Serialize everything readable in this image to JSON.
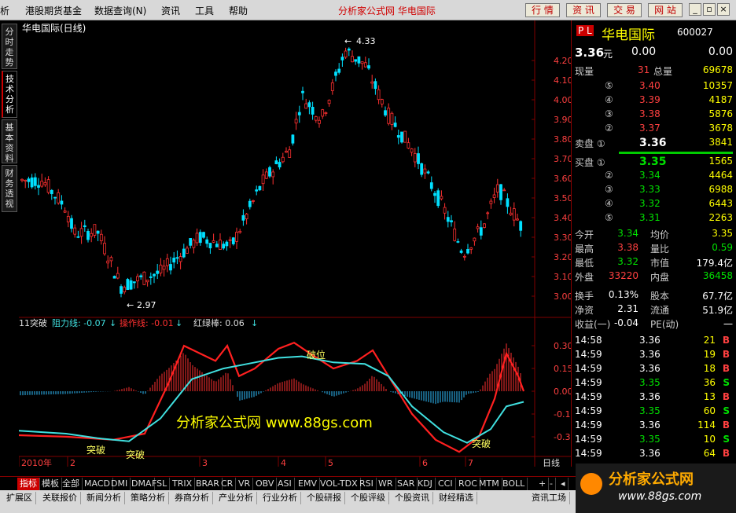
{
  "menu": {
    "items": [
      "析",
      "港股期货基金",
      "数据查询(N)",
      "资讯",
      "工具",
      "帮助"
    ],
    "center_title": "分析家公式网  华电国际",
    "right_buttons": [
      "行 情",
      "资 讯",
      "交 易",
      "网 站"
    ]
  },
  "left_tabs": [
    "分时走势",
    "技术分析",
    "基本资料",
    "财务透视"
  ],
  "chart": {
    "title": "华电国际(日线)",
    "high_label": "4.33",
    "low_label": "2.97",
    "price_ticks": [
      "4.20",
      "4.10",
      "4.00",
      "3.90",
      "3.80",
      "3.70",
      "3.60",
      "3.50",
      "3.40",
      "3.30",
      "3.20",
      "3.10",
      "3.00"
    ],
    "ind_header": {
      "name": "11突破",
      "s1": "阻力线: -0.07",
      "s2": "操作线: -0.01",
      "s3": "红绿棒: 0.06"
    },
    "ind_ticks": [
      "0.30",
      "0.15",
      "0.00",
      "-0.15",
      "-0.30"
    ],
    "annotations": [
      "突破",
      "突破",
      "破位",
      "突破"
    ],
    "xaxis": [
      "2010年",
      "2",
      "3",
      "4",
      "5",
      "6",
      "7"
    ],
    "period": "日线",
    "watermark": "分析家公式网  www.88gs.com"
  },
  "quote": {
    "pl": "P L",
    "name": "华电国际",
    "code": "600027",
    "price": "3.36",
    "unit": "元",
    "chg": "0.00",
    "pct": "0.00",
    "xianliang_label": "现量",
    "xianliang": "31",
    "zongliang_label": "总量",
    "zongliang": "69678",
    "asks": [
      {
        "n": "⑤",
        "p": "3.40",
        "v": "10357"
      },
      {
        "n": "④",
        "p": "3.39",
        "v": "4187"
      },
      {
        "n": "③",
        "p": "3.38",
        "v": "5876"
      },
      {
        "n": "②",
        "p": "3.37",
        "v": "3678"
      },
      {
        "n": "卖盘 ①",
        "p": "3.36",
        "v": "3841"
      }
    ],
    "bids": [
      {
        "n": "买盘 ①",
        "p": "3.35",
        "v": "1565"
      },
      {
        "n": "②",
        "p": "3.34",
        "v": "4464"
      },
      {
        "n": "③",
        "p": "3.33",
        "v": "6988"
      },
      {
        "n": "④",
        "p": "3.32",
        "v": "6443"
      },
      {
        "n": "⑤",
        "p": "3.31",
        "v": "2263"
      }
    ],
    "stats": [
      {
        "l1": "今开",
        "v1": "3.34",
        "l2": "均价",
        "v2": "3.35"
      },
      {
        "l1": "最高",
        "v1": "3.38",
        "l2": "量比",
        "v2": "0.59"
      },
      {
        "l1": "最低",
        "v1": "3.32",
        "l2": "市值",
        "v2": "179.4亿"
      },
      {
        "l1": "外盘",
        "v1": "33220",
        "l2": "内盘",
        "v2": "36458"
      }
    ],
    "stats2": [
      {
        "l1": "换手",
        "v1": "0.13%",
        "l2": "股本",
        "v2": "67.7亿"
      },
      {
        "l1": "净资",
        "v1": "2.31",
        "l2": "流通",
        "v2": "51.9亿"
      },
      {
        "l1": "收益(一)",
        "v1": "-0.04",
        "l2": "PE(动)",
        "v2": "一"
      }
    ],
    "ticks": [
      {
        "t": "14:58",
        "p": "3.36",
        "v": "21",
        "s": "B"
      },
      {
        "t": "14:59",
        "p": "3.36",
        "v": "19",
        "s": "B"
      },
      {
        "t": "14:59",
        "p": "3.36",
        "v": "18",
        "s": "B"
      },
      {
        "t": "14:59",
        "p": "3.35",
        "v": "36",
        "s": "S"
      },
      {
        "t": "14:59",
        "p": "3.36",
        "v": "13",
        "s": "B"
      },
      {
        "t": "14:59",
        "p": "3.35",
        "v": "60",
        "s": "S"
      },
      {
        "t": "14:59",
        "p": "3.36",
        "v": "114",
        "s": "B"
      },
      {
        "t": "14:59",
        "p": "3.35",
        "v": "10",
        "s": "S"
      },
      {
        "t": "14:59",
        "p": "3.36",
        "v": "64",
        "s": "B"
      }
    ]
  },
  "bottom_tabs1": [
    "指标",
    "模板",
    "全部",
    "MACD",
    "DMI",
    "DMA",
    "FSL",
    "TRIX",
    "BRAR",
    "CR",
    "VR",
    "OBV",
    "ASI",
    "EMV",
    "VOL-TDX",
    "RSI",
    "WR",
    "SAR",
    "KDJ",
    "CCI",
    "ROC",
    "MTM",
    "BOLL"
  ],
  "bottom_tabs2": [
    "扩展区",
    "关联报价",
    "新闻分析",
    "策略分析",
    "券商分析",
    "产业分析",
    "行业分析",
    "个股研报",
    "个股评级",
    "个股资讯",
    "财经精选",
    "资讯工场"
  ],
  "logo": {
    "text": "分析家公式网",
    "url": "www.88gs.com"
  },
  "colors": {
    "up": "#ff3030",
    "down": "#00e0ff",
    "bg": "#000000",
    "grid": "#800000"
  }
}
